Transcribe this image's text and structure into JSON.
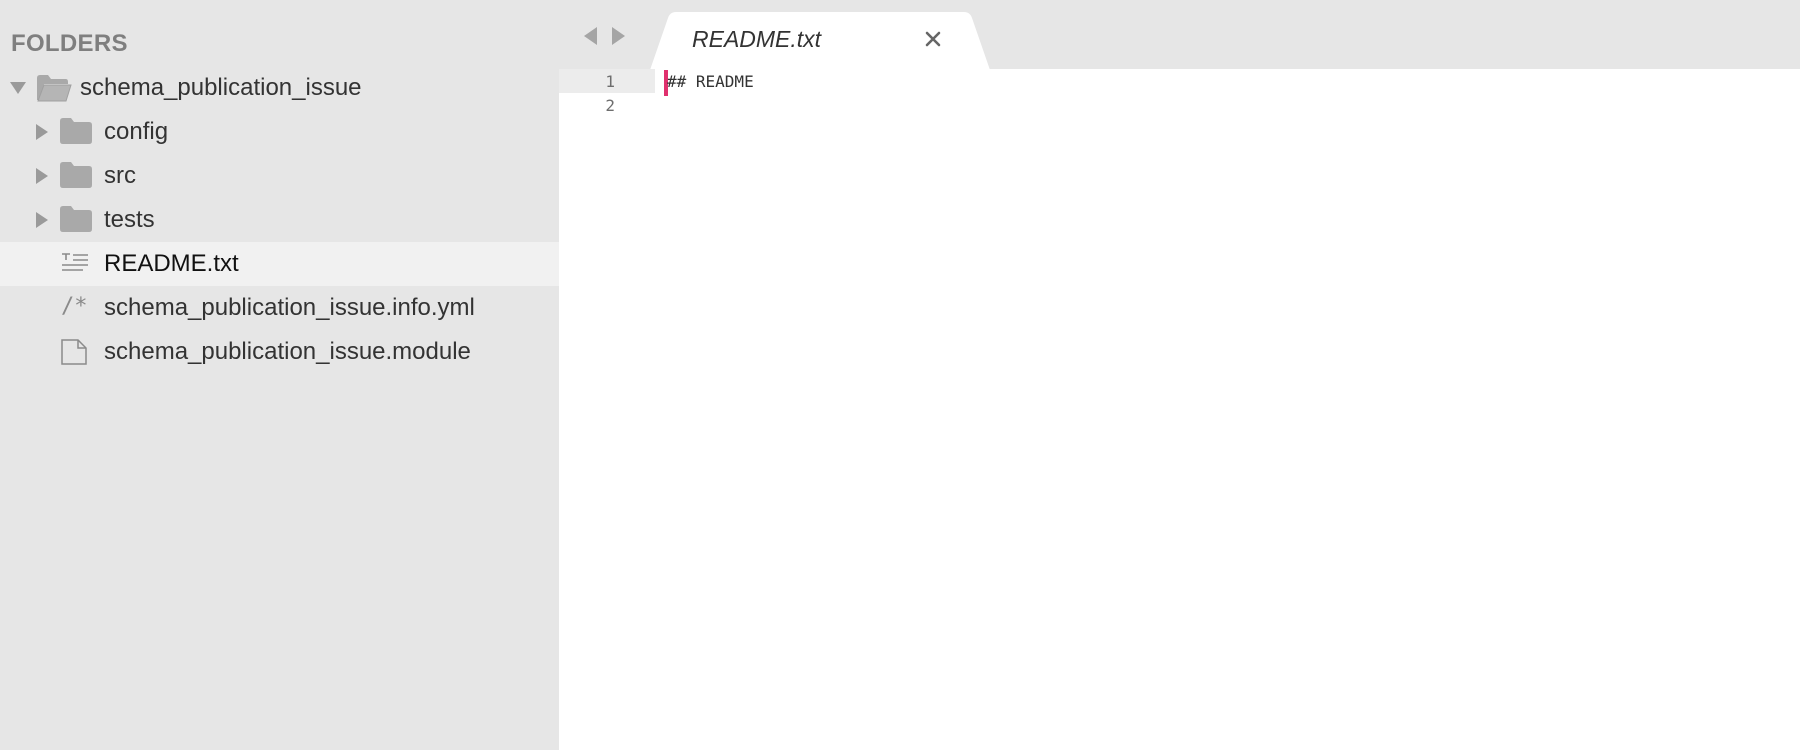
{
  "sidebar": {
    "header": "FOLDERS",
    "root": {
      "label": "schema_publication_issue",
      "expanded": true,
      "icon": "folder-open-icon"
    },
    "items": [
      {
        "label": "config",
        "type": "folder",
        "icon": "folder-icon"
      },
      {
        "label": "src",
        "type": "folder",
        "icon": "folder-icon"
      },
      {
        "label": "tests",
        "type": "folder",
        "icon": "folder-icon"
      },
      {
        "label": "README.txt",
        "type": "file",
        "icon": "text-file-icon",
        "selected": true
      },
      {
        "label": "schema_publication_issue.info.yml",
        "type": "file",
        "icon": "comment-file-icon",
        "icon_text": "/*"
      },
      {
        "label": "schema_publication_issue.module",
        "type": "file",
        "icon": "file-icon"
      }
    ]
  },
  "tabs": {
    "active": {
      "label": "README.txt"
    }
  },
  "editor": {
    "line_numbers": [
      "1",
      "2"
    ],
    "lines": [
      "## README",
      ""
    ]
  },
  "colors": {
    "sidebar_bg": "#e6e6e6",
    "selected_row": "#f1f1f1",
    "caret": "#e0306e",
    "editor_bg": "#ffffff"
  }
}
